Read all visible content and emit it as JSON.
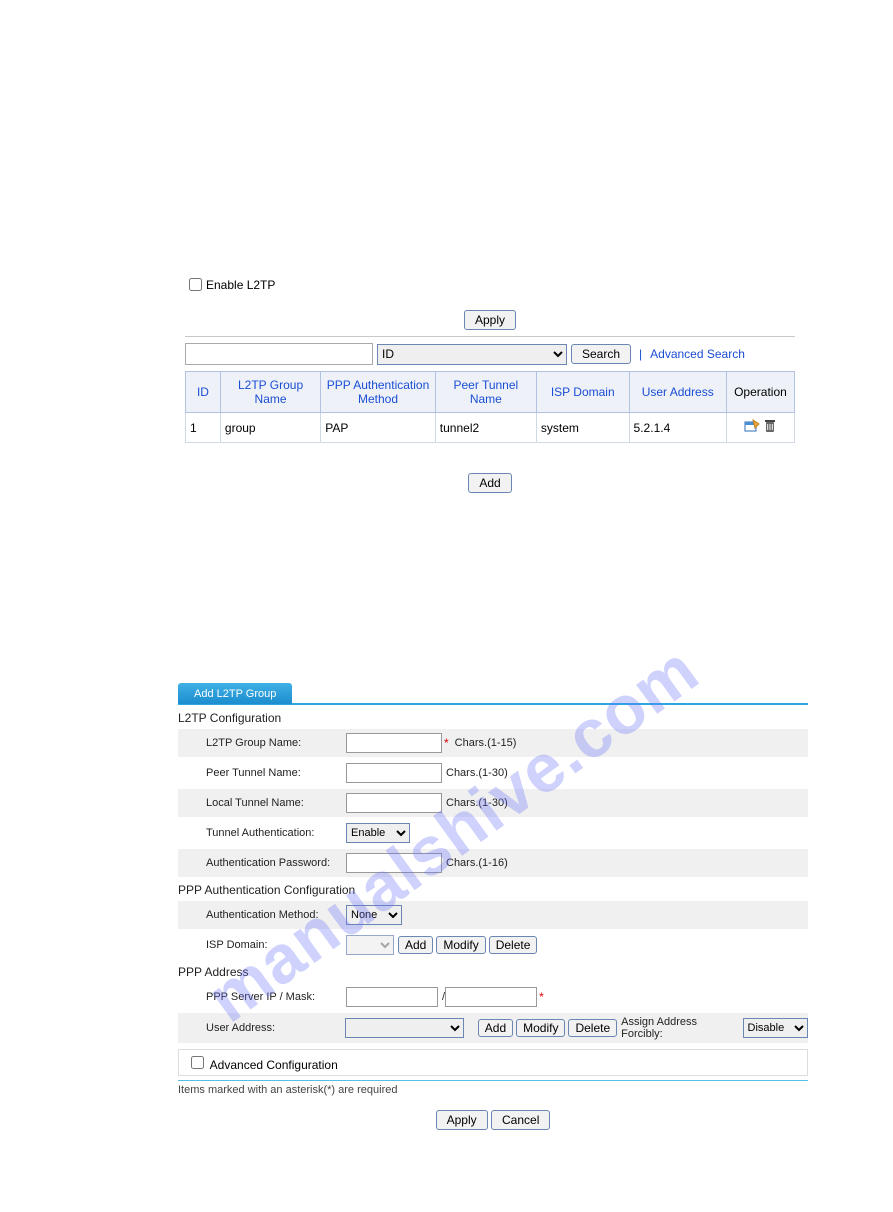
{
  "watermark": "manualshive.com",
  "enable_label": "Enable L2TP",
  "buttons": {
    "apply": "Apply",
    "search": "Search",
    "add": "Add",
    "modify": "Modify",
    "delete": "Delete",
    "cancel": "Cancel"
  },
  "search": {
    "field": "ID"
  },
  "links": {
    "advanced_search": "Advanced Search",
    "separator": "|"
  },
  "grid": {
    "headers": {
      "id": "ID",
      "group": "L2TP Group Name",
      "ppp": "PPP Authentication Method",
      "peer": "Peer Tunnel Name",
      "isp": "ISP Domain",
      "user": "User Address",
      "op": "Operation"
    },
    "rows": [
      {
        "id": "1",
        "group": "group",
        "ppp": "PAP",
        "peer": "tunnel2",
        "isp": "system",
        "user": "5.2.1.4"
      }
    ]
  },
  "form": {
    "tab": "Add L2TP Group",
    "sections": {
      "l2tp": "L2TP Configuration",
      "ppp_auth": "PPP Authentication Configuration",
      "ppp_addr": "PPP Address"
    },
    "labels": {
      "group_name": "L2TP Group Name:",
      "peer_tunnel": "Peer Tunnel Name:",
      "local_tunnel": "Local Tunnel Name:",
      "tunnel_auth": "Tunnel Authentication:",
      "auth_password": "Authentication Password:",
      "auth_method": "Authentication Method:",
      "isp_domain": "ISP Domain:",
      "ppp_server": "PPP Server IP / Mask:",
      "user_address": "User Address:",
      "assign_forcibly": "Assign Address Forcibly:",
      "advanced": "Advanced Configuration"
    },
    "hints": {
      "c1_15": "Chars.(1-15)",
      "c1_30": "Chars.(1-30)",
      "c1_16": "Chars.(1-16)",
      "slash": "/"
    },
    "values": {
      "tunnel_auth": "Enable",
      "auth_method": "None",
      "assign_forcibly": "Disable"
    },
    "footnote": "Items marked with an asterisk(*) are required"
  }
}
